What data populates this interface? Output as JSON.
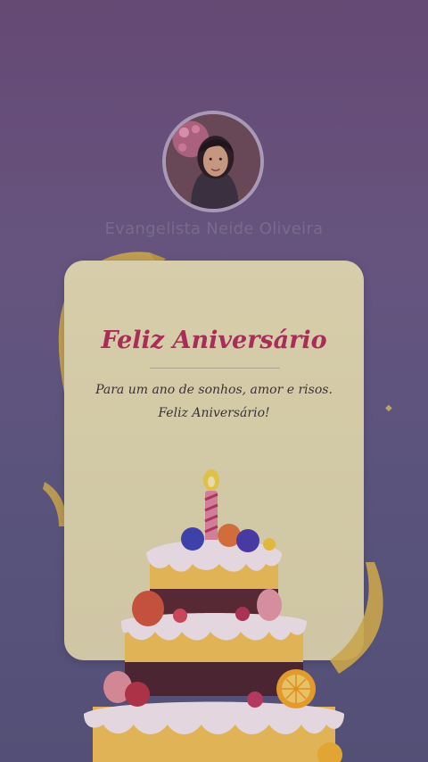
{
  "profile": {
    "name": "Evangelista Neide Oliveira"
  },
  "card": {
    "title": "Feliz Aniversário",
    "message_line1": "Para um ano de sonhos, amor e risos.",
    "message_line2": "Feliz Aniversário!"
  },
  "colors": {
    "title": "#b52f5a",
    "card_background": "#e6ddb3",
    "background_top": "#6a4e7a",
    "background_bottom": "#56547c",
    "ribbon": "#e6c35a"
  },
  "icons": {
    "avatar": "profile-photo",
    "cake": "birthday-cake-illustration",
    "ribbon": "gold-ribbon"
  }
}
